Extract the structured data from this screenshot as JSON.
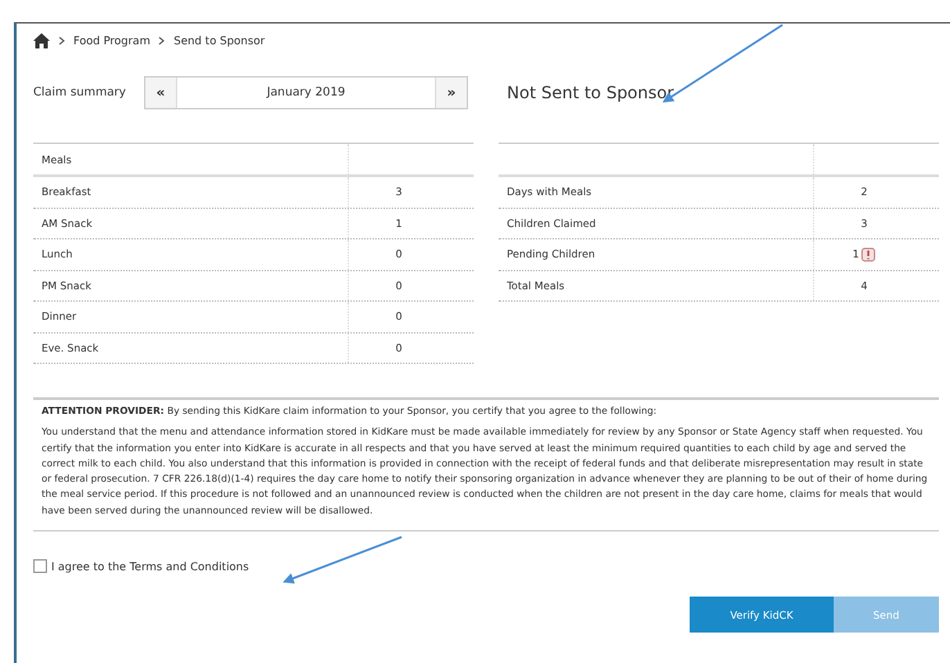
{
  "breadcrumb": [
    "Food Program",
    "Send to Sponsor"
  ],
  "claim_summary": {
    "label": "Claim summary",
    "prev": "«",
    "month": "January 2019",
    "next": "»",
    "status": "Not Sent to Sponsor"
  },
  "meals_table": {
    "header": "Meals",
    "rows": [
      {
        "label": "Breakfast",
        "value": "3"
      },
      {
        "label": "AM Snack",
        "value": "1"
      },
      {
        "label": "Lunch",
        "value": "0"
      },
      {
        "label": "PM Snack",
        "value": "0"
      },
      {
        "label": "Dinner",
        "value": "0"
      },
      {
        "label": "Eve. Snack",
        "value": "0"
      }
    ]
  },
  "totals_table": {
    "rows": [
      {
        "label": "Days with Meals",
        "value": "2",
        "flag": false
      },
      {
        "label": "Children Claimed",
        "value": "3",
        "flag": false
      },
      {
        "label": "Pending Children",
        "value": "1",
        "flag": true
      },
      {
        "label": "Total Meals",
        "value": "4",
        "flag": false
      }
    ]
  },
  "attention": {
    "heading": "**ATTENTION PROVIDER:** By sending this KidKare claim information to your Sponsor, you certify that you agree to the following:",
    "body": "You understand that the menu and attendance information stored in KidKare must be made available immediately for review by any Sponsor or State Agency staff when requested. You certify that the information you enter into KidKare is accurate in all respects and that you have served at least the minimum required quantities to each child by age and served the correct milk to each child. You also understand that this information is provided in connection with the receipt of federal funds and that deliberate misrepresentation may result in state or federal prosecution. 7 CFR 226.18(d)(1-4) requires the day care home to notify their sponsoring organization in advance whenever they are planning to be out of their of home during the meal service period. If this procedure is not followed and an unannounced review is conducted when the children are not present in the day care home, claims for meals that would have been served during the unannounced review will be disallowed."
  },
  "agree": {
    "label": "I agree to the Terms and Conditions",
    "checked": false
  },
  "buttons": [
    {
      "label": "Verify KidCK",
      "disabled": false
    },
    {
      "label": "Send",
      "disabled": true
    }
  ]
}
